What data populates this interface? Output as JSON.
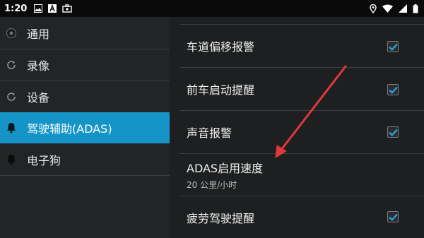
{
  "status_bar": {
    "time": "1:20",
    "left_icons": [
      "image-icon",
      "text-a-icon",
      "briefcase-icon"
    ],
    "right_icons": [
      "location-icon",
      "wifi-icon",
      "signal-icon",
      "battery-icon"
    ]
  },
  "sidebar": {
    "items": [
      {
        "label": "通用",
        "icon": "gear-icon",
        "active": false
      },
      {
        "label": "录像",
        "icon": "refresh-icon",
        "active": false
      },
      {
        "label": "设备",
        "icon": "refresh-icon",
        "active": false
      },
      {
        "label": "驾驶辅助(ADAS)",
        "icon": "bell-icon",
        "active": true
      },
      {
        "label": "电子狗",
        "icon": "bell-icon",
        "active": false
      }
    ]
  },
  "settings": {
    "rows": [
      {
        "title": "车道偏移报警",
        "checked": true
      },
      {
        "title": "前车启动提醒",
        "checked": true
      },
      {
        "title": "声音报警",
        "checked": true
      },
      {
        "title": "ADAS启用速度",
        "subtitle": "20 公里/小时"
      },
      {
        "title": "疲劳驾驶提醒",
        "checked": true
      }
    ]
  },
  "colors": {
    "accent": "#1595c7",
    "check": "#2a9fd6",
    "annotation_arrow": "#e0393a"
  }
}
